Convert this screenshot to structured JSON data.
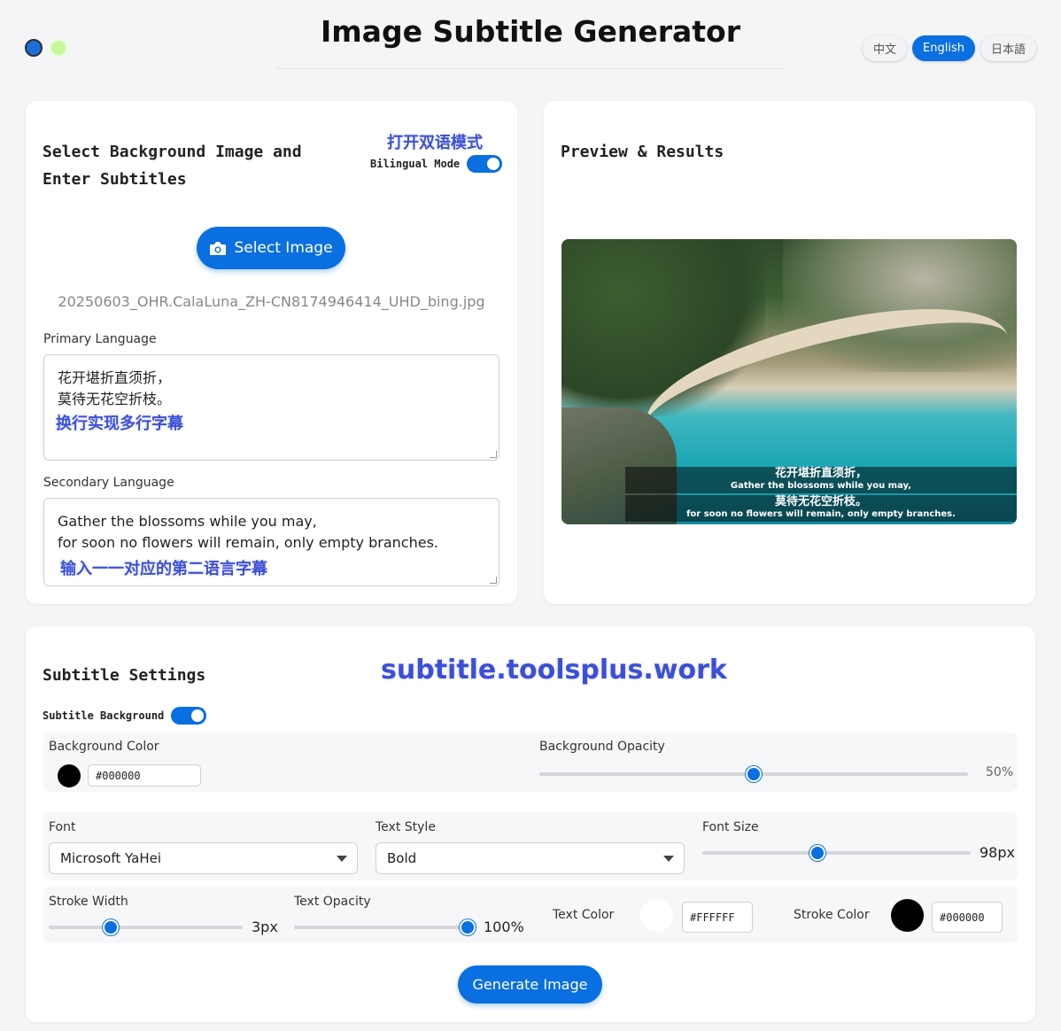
{
  "app": {
    "title": "Image Subtitle Generator",
    "languages": [
      "中文",
      "English",
      "日本語"
    ],
    "active_language": "English"
  },
  "upload": {
    "section_title": "Select Background Image and Enter Subtitles",
    "annotation_bilingual": "打开双语模式",
    "bilingual_label": "Bilingual Mode",
    "bilingual_on": true,
    "select_button": "Select Image",
    "filename": "20250603_OHR.CalaLuna_ZH-CN8174946414_UHD_bing.jpg",
    "primary_label": "Primary Language",
    "primary_lines": [
      "花开堪折直须折，",
      "莫待无花空折枝。"
    ],
    "annotation_multiline": "换行实现多行字幕",
    "secondary_label": "Secondary Language",
    "secondary_lines": [
      "Gather the blossoms while you may,",
      "for soon no flowers will remain, only empty branches."
    ],
    "annotation_secondary": "输入一一对应的第二语言字幕"
  },
  "preview": {
    "section_title": "Preview & Results",
    "subtitles": [
      {
        "zh": "花开堪折直须折，",
        "en": "Gather the blossoms while you may,"
      },
      {
        "zh": "莫待无花空折枝。",
        "en": "for soon no flowers will remain, only empty branches."
      }
    ]
  },
  "settings": {
    "section_title": "Subtitle Settings",
    "annotation_url": "subtitle.toolsplus.work",
    "subtitle_background_label": "Subtitle Background",
    "subtitle_background_on": true,
    "bg_color_label": "Background Color",
    "bg_color": "#000000",
    "bg_opacity_label": "Background Opacity",
    "bg_opacity": "50%",
    "bg_opacity_fraction": 0.5,
    "font_label": "Font",
    "font_value": "Microsoft YaHei",
    "text_style_label": "Text Style",
    "text_style_value": "Bold",
    "font_size_label": "Font Size",
    "font_size_value": "98px",
    "font_size_fraction": 0.43,
    "stroke_width_label": "Stroke Width",
    "stroke_width_value": "3px",
    "stroke_width_fraction": 0.32,
    "text_opacity_label": "Text Opacity",
    "text_opacity_value": "100%",
    "text_opacity_fraction": 1.0,
    "text_color_label": "Text Color",
    "text_color": "#FFFFFF",
    "stroke_color_label": "Stroke Color",
    "stroke_color": "#000000",
    "generate_button": "Generate Image"
  },
  "colors": {
    "accent": "#0a6fe0",
    "annotation": "#3b4fd8",
    "window_dot_blue": "#1c6fd6",
    "window_dot_green": "#c6f79a"
  }
}
